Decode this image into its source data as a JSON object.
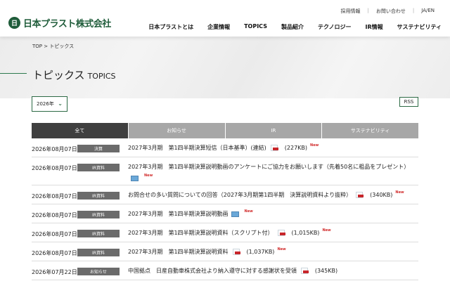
{
  "header": {
    "logo_mark": "日",
    "logo_text": "日本プラスト株式会社",
    "utility": [
      "採用情報",
      "お問い合わせ",
      "JA/EN"
    ],
    "nav": [
      "日本プラストとは",
      "企業情報",
      "TOPICS",
      "製品紹介",
      "テクノロジー",
      "IR情報",
      "サステナビリティ"
    ]
  },
  "breadcrumb": "TOP > トピックス",
  "page_title": {
    "ja": "トピックス",
    "en": "TOPICS"
  },
  "year_select": {
    "value": "2026年",
    "icon": "chevron-down-icon"
  },
  "rss_label": "RSS",
  "tabs": [
    "全て",
    "お知らせ",
    "IR",
    "サステナビリティ"
  ],
  "active_tab": "全て",
  "news": [
    {
      "date": "2026年08月07日",
      "category": "決算",
      "title": "2027年3月期　第1四半期決算短信（日本基準）(連結)",
      "icon": "pdf-icon",
      "size": "(227KB)",
      "new_label": "New"
    },
    {
      "date": "2026年08月07日",
      "category": "IR資料",
      "title": "2027年3月期　第1四半期決算説明動画のアンケートにご協力をお願いします（先着50名に粗品をプレゼント）",
      "icon": "video-icon",
      "size": "",
      "new_label": "New"
    },
    {
      "date": "2026年08月07日",
      "category": "IR資料",
      "title": "お問合せの多い質問についての回答（2027年3月期第1四半期　決算説明資料より抜粋）",
      "icon": "pdf-icon",
      "size": "(340KB)",
      "new_label": "New"
    },
    {
      "date": "2026年08月07日",
      "category": "IR資料",
      "title": "2027年3月期　第1四半期決算説明動画",
      "icon": "video-icon",
      "size": "",
      "new_label": "New"
    },
    {
      "date": "2026年08月07日",
      "category": "IR資料",
      "title": "2027年3月期　第1四半期決算説明資料（スクリプト付）",
      "icon": "pdf-icon",
      "size": "(1,015KB)",
      "new_label": "New"
    },
    {
      "date": "2026年08月07日",
      "category": "IR資料",
      "title": "2027年3月期　第1四半期決算説明資料",
      "icon": "pdf-icon",
      "size": "(1,037KB)",
      "new_label": "New"
    },
    {
      "date": "2026年07月22日",
      "category": "お知らせ",
      "title": "中国拠点　日産自動車株式会社より納入遵守に対する感謝状を受領",
      "icon": "pdf-icon",
      "size": "(345KB)",
      "new_label": ""
    }
  ]
}
